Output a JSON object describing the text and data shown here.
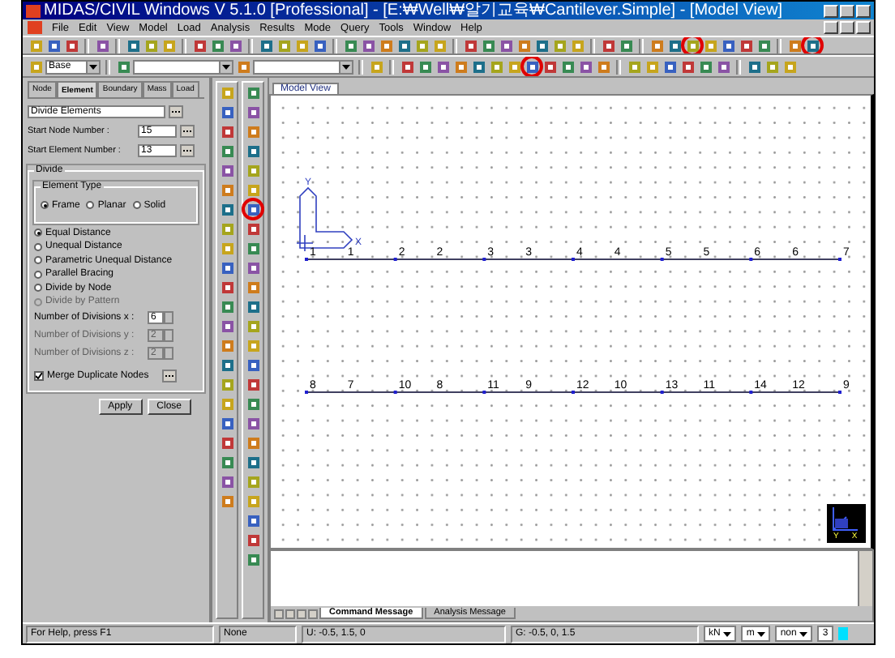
{
  "window": {
    "title": "MIDAS/CIVIL Windows V 5.1.0 [Professional] - [E:₩Well₩알기교육₩Cantilever.Simple] - [Model View]"
  },
  "menu": [
    "File",
    "Edit",
    "View",
    "Model",
    "Load",
    "Analysis",
    "Results",
    "Mode",
    "Query",
    "Tools",
    "Window",
    "Help"
  ],
  "toolbar_1": [
    {
      "kind": "icon",
      "circled": false
    },
    {
      "kind": "icon",
      "circled": false
    },
    {
      "kind": "icon",
      "circled": false
    },
    {
      "kind": "separator"
    },
    {
      "kind": "icon",
      "circled": false
    },
    {
      "kind": "separator"
    },
    {
      "kind": "icon",
      "circled": false
    },
    {
      "kind": "icon",
      "circled": false
    },
    {
      "kind": "icon",
      "circled": false
    },
    {
      "kind": "separator"
    },
    {
      "kind": "icon",
      "circled": false
    },
    {
      "kind": "icon",
      "circled": false
    },
    {
      "kind": "icon",
      "circled": false
    },
    {
      "kind": "separator"
    },
    {
      "kind": "icon",
      "circled": false
    },
    {
      "kind": "icon",
      "circled": false
    },
    {
      "kind": "icon",
      "circled": false
    },
    {
      "kind": "icon",
      "circled": false
    },
    {
      "kind": "separator"
    },
    {
      "kind": "icon",
      "circled": false
    },
    {
      "kind": "icon",
      "circled": false
    },
    {
      "kind": "icon",
      "circled": false
    },
    {
      "kind": "icon",
      "circled": false
    },
    {
      "kind": "icon",
      "circled": false
    },
    {
      "kind": "icon",
      "circled": false
    },
    {
      "kind": "separator"
    },
    {
      "kind": "icon",
      "circled": false
    },
    {
      "kind": "icon",
      "circled": false
    },
    {
      "kind": "icon",
      "circled": false
    },
    {
      "kind": "icon",
      "circled": false
    },
    {
      "kind": "icon",
      "circled": false
    },
    {
      "kind": "icon",
      "circled": false
    },
    {
      "kind": "icon",
      "circled": false
    },
    {
      "kind": "separator"
    },
    {
      "kind": "icon",
      "circled": false
    },
    {
      "kind": "icon",
      "circled": false
    },
    {
      "kind": "separator"
    },
    {
      "kind": "icon",
      "circled": false
    },
    {
      "kind": "icon",
      "circled": false
    },
    {
      "kind": "icon",
      "circled": true
    },
    {
      "kind": "icon",
      "circled": false
    },
    {
      "kind": "icon",
      "circled": false
    },
    {
      "kind": "icon",
      "circled": false
    },
    {
      "kind": "icon",
      "circled": false
    },
    {
      "kind": "separator"
    },
    {
      "kind": "icon",
      "circled": false
    },
    {
      "kind": "icon",
      "circled": true
    }
  ],
  "toolbar_2": [
    {
      "kind": "icon",
      "circled": false
    },
    {
      "kind": "combo",
      "value": "Base"
    },
    {
      "kind": "separator"
    },
    {
      "kind": "icon",
      "circled": false
    },
    {
      "kind": "combo"
    },
    {
      "kind": "icon",
      "circled": false
    },
    {
      "kind": "combo"
    },
    {
      "kind": "separator"
    },
    {
      "kind": "icon",
      "circled": false
    },
    {
      "kind": "separator"
    },
    {
      "kind": "icon",
      "circled": false
    },
    {
      "kind": "icon",
      "circled": false
    },
    {
      "kind": "icon",
      "circled": false
    },
    {
      "kind": "icon",
      "circled": false
    },
    {
      "kind": "icon",
      "circled": false
    },
    {
      "kind": "icon",
      "circled": false
    },
    {
      "kind": "icon",
      "circled": false
    },
    {
      "kind": "icon",
      "circled": true
    },
    {
      "kind": "icon",
      "circled": false
    },
    {
      "kind": "icon",
      "circled": false
    },
    {
      "kind": "icon",
      "circled": false
    },
    {
      "kind": "icon",
      "circled": false
    },
    {
      "kind": "separator"
    },
    {
      "kind": "icon",
      "circled": false
    },
    {
      "kind": "icon",
      "circled": false
    },
    {
      "kind": "icon",
      "circled": false
    },
    {
      "kind": "icon",
      "circled": false
    },
    {
      "kind": "icon",
      "circled": false
    },
    {
      "kind": "icon",
      "circled": false
    },
    {
      "kind": "separator"
    },
    {
      "kind": "icon",
      "circled": false
    },
    {
      "kind": "icon",
      "circled": false
    },
    {
      "kind": "icon",
      "circled": false
    }
  ],
  "panel": {
    "tabs": [
      {
        "label": "Node",
        "selected": false
      },
      {
        "label": "Element",
        "selected": true
      },
      {
        "label": "Boundary",
        "selected": false
      },
      {
        "label": "Mass",
        "selected": false
      },
      {
        "label": "Load",
        "selected": false
      }
    ],
    "function": "Divide Elements",
    "start_fields": [
      {
        "label": "Start Node Number :",
        "value": "15"
      },
      {
        "label": "Start Element Number :",
        "value": "13"
      }
    ],
    "divide": {
      "title": "Divide",
      "element_type": {
        "title": "Element Type",
        "options": [
          {
            "label": "Frame",
            "selected": true
          },
          {
            "label": "Planar",
            "selected": false
          },
          {
            "label": "Solid",
            "selected": false
          }
        ]
      },
      "methods": [
        {
          "label": "Equal Distance",
          "selected": true,
          "disabled": false
        },
        {
          "label": "Unequal Distance",
          "selected": false,
          "disabled": false
        },
        {
          "label": "Parametric Unequal Distance",
          "selected": false,
          "disabled": false
        },
        {
          "label": "Parallel Bracing",
          "selected": false,
          "disabled": false
        },
        {
          "label": "Divide by Node",
          "selected": false,
          "disabled": false
        },
        {
          "label": "Divide by Pattern",
          "selected": false,
          "disabled": true
        }
      ],
      "divisions": [
        {
          "label": "Number of Divisions x :",
          "value": "6",
          "disabled": false
        },
        {
          "label": "Number of Divisions y :",
          "value": "2",
          "disabled": true
        },
        {
          "label": "Number of Divisions z :",
          "value": "2",
          "disabled": true
        }
      ]
    },
    "merge": {
      "label": "Merge Duplicate Nodes",
      "checked": true
    },
    "buttons": [
      "Apply",
      "Close"
    ]
  },
  "side_tools": [
    [
      {
        "circled": false
      },
      {
        "circled": false
      },
      {
        "circled": false
      },
      {
        "circled": false
      },
      {
        "circled": false
      },
      {
        "circled": false
      },
      {
        "circled": false
      },
      {
        "circled": false
      },
      {
        "circled": false
      },
      {
        "circled": false
      },
      {
        "circled": false
      },
      {
        "circled": false
      },
      {
        "circled": false
      },
      {
        "circled": false
      },
      {
        "circled": false
      },
      {
        "circled": false
      },
      {
        "circled": false
      },
      {
        "circled": false
      },
      {
        "circled": false
      },
      {
        "circled": false
      },
      {
        "circled": false
      },
      {
        "circled": false
      }
    ],
    [
      {
        "circled": false
      },
      {
        "circled": false
      },
      {
        "circled": false
      },
      {
        "circled": false
      },
      {
        "circled": false
      },
      {
        "circled": false
      },
      {
        "circled": true
      },
      {
        "circled": false
      },
      {
        "circled": false
      },
      {
        "circled": false
      },
      {
        "circled": false
      },
      {
        "circled": false
      },
      {
        "circled": false
      },
      {
        "circled": false
      },
      {
        "circled": false
      },
      {
        "circled": false
      },
      {
        "circled": false
      },
      {
        "circled": false
      },
      {
        "circled": false
      },
      {
        "circled": false
      },
      {
        "circled": false
      },
      {
        "circled": false
      },
      {
        "circled": false
      },
      {
        "circled": false
      },
      {
        "circled": false
      }
    ]
  ],
  "model_view": {
    "tab": "Model View",
    "ucs_axes": [
      "Y",
      "X"
    ],
    "beams": [
      {
        "labels": [
          "1",
          "1",
          "2",
          "2",
          "3",
          "3",
          "4",
          "4",
          "5",
          "5",
          "6",
          "6",
          "7"
        ]
      },
      {
        "labels": [
          "8",
          "7",
          "10",
          "8",
          "11",
          "9",
          "12",
          "10",
          "13",
          "11",
          "14",
          "12",
          "9"
        ]
      }
    ],
    "view_axes": [
      "Y",
      "X"
    ]
  },
  "message_tabs": [
    {
      "label": "Command Message",
      "selected": true
    },
    {
      "label": "Analysis Message",
      "selected": false
    }
  ],
  "status_bar": {
    "help": "For Help, press F1",
    "selection": "None",
    "ucs_coords": "U: -0.5, 1.5, 0",
    "global_coords": "G: -0.5, 0, 1.5",
    "force_unit": "kN",
    "length_unit": "m",
    "filter": "non",
    "count": "3"
  }
}
